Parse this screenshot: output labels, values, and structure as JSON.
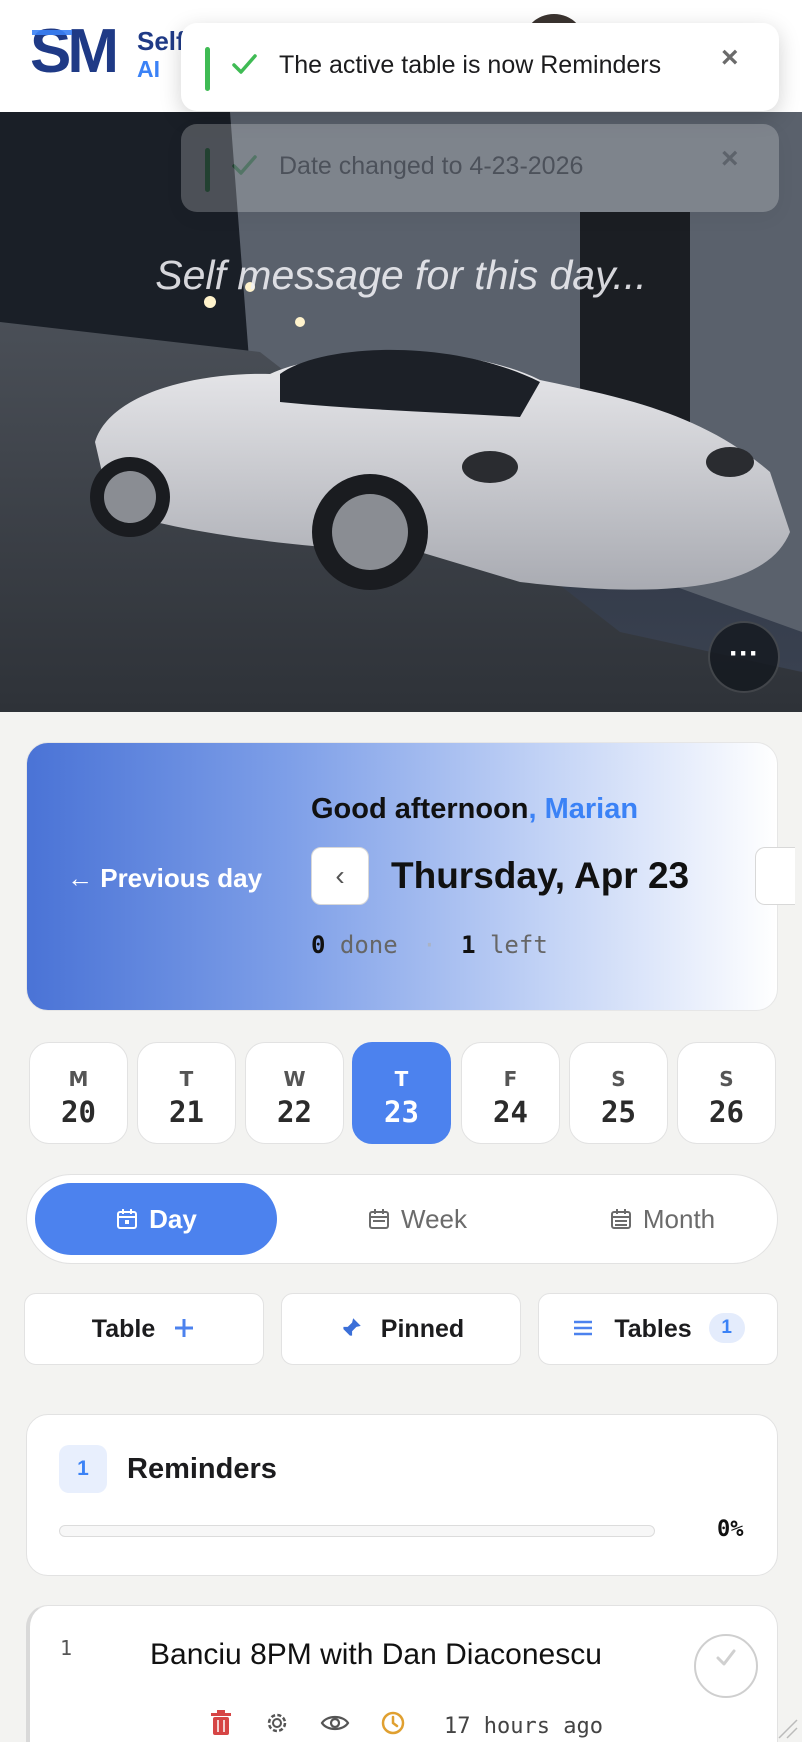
{
  "header": {
    "logo_mark": "SM",
    "brand_line1": "Self",
    "brand_line2": "AI"
  },
  "toasts": [
    {
      "message": "The active table is now Reminders",
      "icon": "check-icon",
      "close": "×"
    },
    {
      "message": "Date changed to 4-23-2026",
      "icon": "check-icon",
      "close": "×"
    }
  ],
  "hero": {
    "self_message_placeholder": "Self message for this day...",
    "more_button": "···"
  },
  "greeting_card": {
    "previous_day": "← Previous day",
    "greeting": "Good afternoon",
    "greeting_comma": ",",
    "user_name": "Marian",
    "back_chevron": "‹",
    "date_title": "Thursday, Apr 23",
    "done_count": "0",
    "done_label": "done",
    "separator": "·",
    "left_count": "1",
    "left_label": "left"
  },
  "week": [
    {
      "letter": "M",
      "num": "20",
      "active": false
    },
    {
      "letter": "T",
      "num": "21",
      "active": false
    },
    {
      "letter": "W",
      "num": "22",
      "active": false
    },
    {
      "letter": "T",
      "num": "23",
      "active": true
    },
    {
      "letter": "F",
      "num": "24",
      "active": false
    },
    {
      "letter": "S",
      "num": "25",
      "active": false
    },
    {
      "letter": "S",
      "num": "26",
      "active": false
    }
  ],
  "views": {
    "day": "Day",
    "week": "Week",
    "month": "Month",
    "active": "Day"
  },
  "actions": {
    "table": "Table",
    "pinned": "Pinned",
    "tables": "Tables",
    "tables_count": "1"
  },
  "reminders": {
    "count": "1",
    "title": "Reminders",
    "progress_percent": 0,
    "progress_label": "0%"
  },
  "items": [
    {
      "index": "1",
      "text": "Banciu 8PM with Dan Diaconescu",
      "time": "17 hours ago"
    }
  ],
  "colors": {
    "accent": "#4c82ee",
    "brand_navy": "#1f3a86",
    "success": "#3fbb54",
    "delete": "#d64545",
    "clock": "#e0a030"
  }
}
